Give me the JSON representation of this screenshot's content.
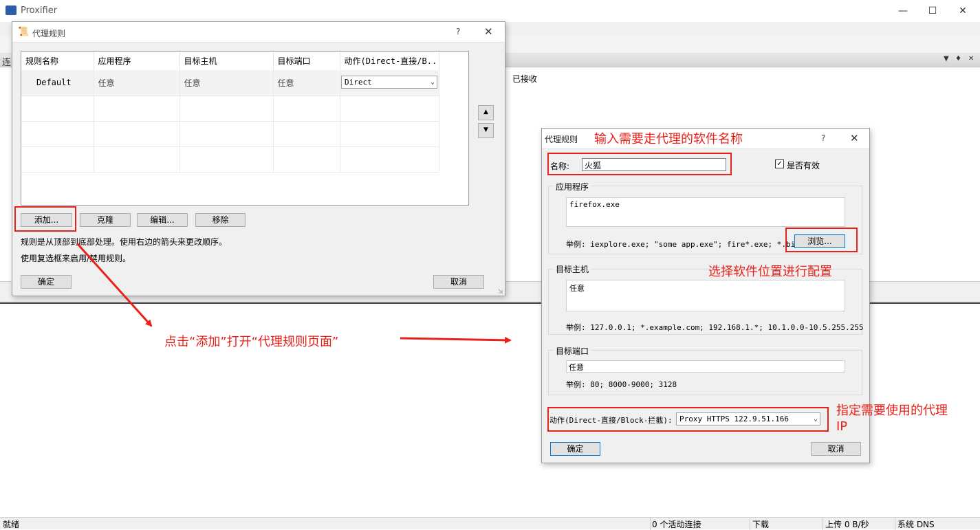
{
  "main_window": {
    "title": "Proxifier",
    "conn_tab_fragment": "连",
    "col_received": "已接收",
    "status": {
      "ready": "就绪",
      "active_connections": "0 个活动连接",
      "download": "下载",
      "upload": "上传 0 B/秒",
      "dns": "系统 DNS"
    }
  },
  "rules_dialog": {
    "title": "代理规则",
    "help": "?",
    "columns": [
      "规则名称",
      "应用程序",
      "目标主机",
      "目标端口",
      "动作(Direct-直接/B..."
    ],
    "rows": [
      {
        "name": "Default",
        "app": "任意",
        "host": "任意",
        "port": "任意",
        "action": "Direct"
      }
    ],
    "buttons": {
      "add": "添加...",
      "clone": "克隆",
      "edit": "编辑...",
      "remove": "移除",
      "ok": "确定",
      "cancel": "取消"
    },
    "info1": "规则是从顶部到底部处理。使用右边的箭头来更改顺序。",
    "info2": "使用复选框来启用/禁用规则。"
  },
  "rule_dialog": {
    "title": "代理规则",
    "help": "?",
    "name_label": "名称:",
    "name_value": "火狐",
    "enabled_label": "是否有效",
    "enabled": true,
    "app_group": "应用程序",
    "app_value": "firefox.exe",
    "app_hint": "举例: iexplore.exe; \"some app.exe\"; fire*.exe; *.bin",
    "browse": "浏览...",
    "host_group": "目标主机",
    "host_value": "任意",
    "host_hint": "举例: 127.0.0.1; *.example.com; 192.168.1.*; 10.1.0.0-10.5.255.255",
    "port_group": "目标端口",
    "port_value": "任意",
    "port_hint": "举例: 80; 8000-9000; 3128",
    "action_label": "动作(Direct-直接/Block-拦截):",
    "action_value": "Proxy HTTPS 122.9.51.166",
    "ok": "确定",
    "cancel": "取消"
  },
  "annotations": {
    "name_tip": "输入需要走代理的软件名称",
    "browse_tip": "选择软件位置进行配置",
    "add_tip": "点击“添加”打开“代理规则页面”",
    "proxy_tip_line1": "指定需要使用的代理",
    "proxy_tip_line2": "IP"
  },
  "colors": {
    "annotation_red": "#e8211a",
    "dialog_bg": "#f0f0f0",
    "focus_blue": "#0078d7"
  }
}
